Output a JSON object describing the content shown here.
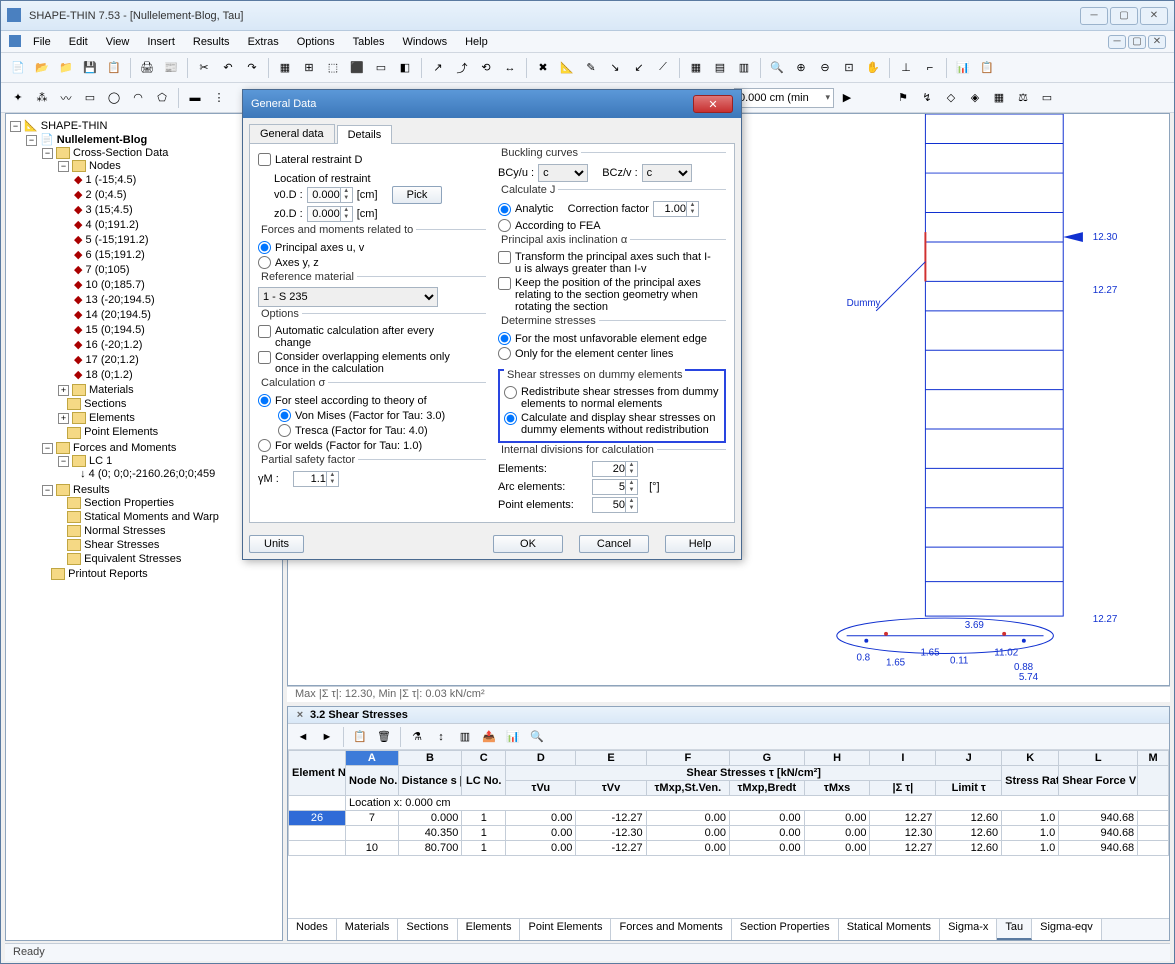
{
  "window": {
    "title": "SHAPE-THIN 7.53 - [Nullelement-Blog, Tau]"
  },
  "menu": [
    "File",
    "Edit",
    "View",
    "Insert",
    "Results",
    "Extras",
    "Options",
    "Tables",
    "Windows",
    "Help"
  ],
  "combo_x": "0.000 cm (min",
  "tree": {
    "root": "SHAPE-THIN",
    "project": "Nullelement-Blog",
    "csd": "Cross-Section Data",
    "nodes_label": "Nodes",
    "nodes": [
      "1  (-15;4.5)",
      "2  (0;4.5)",
      "3  (15;4.5)",
      "4  (0;191.2)",
      "5  (-15;191.2)",
      "6  (15;191.2)",
      "7  (0;105)",
      "10  (0;185.7)",
      "13  (-20;194.5)",
      "14  (20;194.5)",
      "15  (0;194.5)",
      "16  (-20;1.2)",
      "17  (20;1.2)",
      "18  (0;1.2)"
    ],
    "materials": "Materials",
    "sections": "Sections",
    "elements": "Elements",
    "pointel": "Point Elements",
    "fm": "Forces and Moments",
    "lc": "LC 1",
    "lc_val": "4  (0; 0;0;-2160.26;0;0;459",
    "results": "Results",
    "res_items": [
      "Section Properties",
      "Statical Moments and Warp",
      "Normal Stresses",
      "Shear Stresses",
      "Equivalent Stresses"
    ],
    "printout": "Printout Reports"
  },
  "canvas": {
    "dummy": "Dummy",
    "v1": "12.30",
    "v2": "12.27",
    "v3": "12.27",
    "status": "Max |Σ τ|: 12.30, Min |Σ τ|: 0.03 kN/cm²"
  },
  "dialog": {
    "title": "General Data",
    "tab_general": "General data",
    "tab_details": "Details",
    "lateral": "Lateral restraint D",
    "loc_restraint": "Location of restraint",
    "v0d": "v0.D :",
    "z0d": "z0.D :",
    "cm": "[cm]",
    "pick": "Pick",
    "v0d_val": "0.000",
    "z0d_val": "0.000",
    "forces_grp": "Forces and moments related to",
    "opt_uv": "Principal axes u, v",
    "opt_yz": "Axes y, z",
    "refmat": "Reference material",
    "refmat_val": "1 - S 235",
    "options": "Options",
    "auto_calc": "Automatic calculation after every change",
    "overlap": "Consider overlapping elements only once in the calculation",
    "calc_sigma": "Calculation σ",
    "steel": "For steel according to theory of",
    "vonmises": "Von Mises (Factor for Tau: 3.0)",
    "tresca": "Tresca (Factor for Tau: 4.0)",
    "welds": "For welds (Factor for Tau: 1.0)",
    "psf": "Partial safety factor",
    "gamma": "γM :",
    "gamma_val": "1.1",
    "buckling": "Buckling curves",
    "bcyu": "BCy/u :",
    "bczv": "BCz/v :",
    "bc_val": "c",
    "calcJ": "Calculate J",
    "analytic": "Analytic",
    "corr": "Correction factor",
    "corr_val": "1.00",
    "fea": "According to FEA",
    "pai": "Principal axis inclination α",
    "transform": "Transform the principal axes such that  I-u is always greater than I-v",
    "keeppos": "Keep the position of the principal axes relating to the section geometry when rotating the section",
    "det": "Determine stresses",
    "unfav": "For the most unfavorable element edge",
    "center": "Only for the element center lines",
    "shear": "Shear stresses on dummy elements",
    "redistribute": "Redistribute shear stresses from dummy elements to normal elements",
    "calc_disp": "Calculate and display shear stresses on dummy elements without redistribution",
    "intdiv": "Internal divisions for calculation",
    "el": "Elements:",
    "arcel": "Arc elements:",
    "ptel": "Point elements:",
    "el_val": "20",
    "arc_val": "5",
    "pt_val": "50",
    "deg": "[°]",
    "units": "Units",
    "ok": "OK",
    "cancel": "Cancel",
    "help": "Help"
  },
  "panel": {
    "title": "3.2 Shear Stresses",
    "cols_letter": [
      "A",
      "B",
      "C",
      "D",
      "E",
      "F",
      "G",
      "H",
      "I",
      "J",
      "K",
      "L",
      "M"
    ],
    "h_elno": "Element No.",
    "h_nodeno": "Node No.",
    "h_dist": "Distance s [cm]",
    "h_lcno": "LC No.",
    "h_shear": "Shear Stresses τ [kN/cm²]",
    "h_ratio": "Stress Ratio",
    "h_shearforce": "Shear Force V [kN]",
    "sub": [
      "τVu",
      "τVv",
      "τMxp,St.Ven.",
      "τMxp,Bredt",
      "τMxs",
      "|Σ τ|",
      "Limit τ"
    ],
    "locrow": "Location x: 0.000 cm",
    "rows": [
      {
        "el": "26",
        "n": "7",
        "s": "0.000",
        "lc": "1",
        "vu": "0.00",
        "vv": "-12.27",
        "sv": "0.00",
        "br": "0.00",
        "mxs": "0.00",
        "sum": "12.27",
        "lim": "12.60",
        "ratio": "1.0",
        "vf": "940.68"
      },
      {
        "el": "",
        "n": "",
        "s": "40.350",
        "lc": "1",
        "vu": "0.00",
        "vv": "-12.30",
        "sv": "0.00",
        "br": "0.00",
        "mxs": "0.00",
        "sum": "12.30",
        "lim": "12.60",
        "ratio": "1.0",
        "vf": "940.68"
      },
      {
        "el": "",
        "n": "10",
        "s": "80.700",
        "lc": "1",
        "vu": "0.00",
        "vv": "-12.27",
        "sv": "0.00",
        "br": "0.00",
        "mxs": "0.00",
        "sum": "12.27",
        "lim": "12.60",
        "ratio": "1.0",
        "vf": "940.68"
      }
    ],
    "tabs": [
      "Nodes",
      "Materials",
      "Sections",
      "Elements",
      "Point Elements",
      "Forces and Moments",
      "Section Properties",
      "Statical Moments",
      "Sigma-x",
      "Tau",
      "Sigma-eqv"
    ]
  },
  "statusbar": "Ready"
}
